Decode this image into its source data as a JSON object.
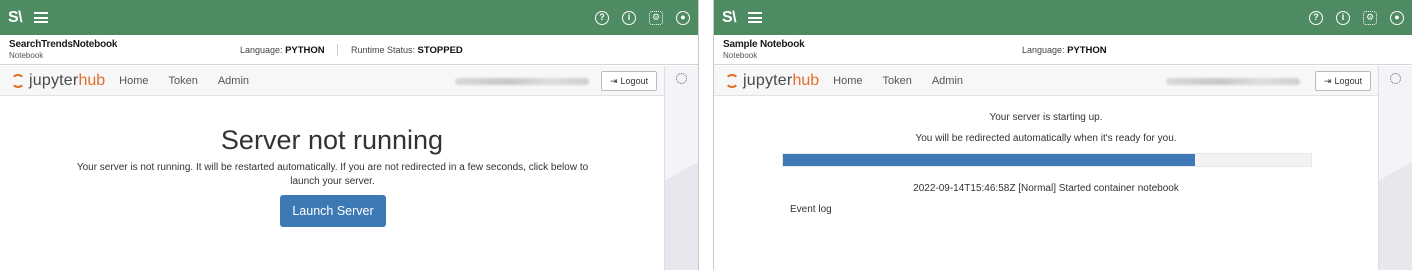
{
  "brand": "S\\",
  "left": {
    "notebook_name": "SearchTrendsNotebook",
    "notebook_type": "Notebook",
    "language_label": "Language:",
    "language_value": "PYTHON",
    "runtime_label": "Runtime Status:",
    "runtime_value": "STOPPED",
    "nav": {
      "home": "Home",
      "token": "Token",
      "admin": "Admin"
    },
    "logout": "Logout",
    "title": "Server not running",
    "message": "Your server is not running. It will be restarted automatically. If you are not redirected in a few seconds, click below to launch your server.",
    "launch_button": "Launch Server"
  },
  "right": {
    "notebook_name": "Sample Notebook",
    "notebook_type": "Notebook",
    "language_label": "Language:",
    "language_value": "PYTHON",
    "nav": {
      "home": "Home",
      "token": "Token",
      "admin": "Admin"
    },
    "logout": "Logout",
    "starting": "Your server is starting up.",
    "redirect": "You will be redirected automatically when it's ready for you.",
    "progress": 0.78,
    "event": "2022-09-14T15:46:58Z [Normal] Started container notebook",
    "event_log": "Event log"
  },
  "jupyter": {
    "part1": "jupyter",
    "part2": "hub"
  },
  "colors": {
    "topbar": "#4e8a62",
    "accent": "#3d79b5",
    "jupyter_orange": "#e46e2e"
  }
}
